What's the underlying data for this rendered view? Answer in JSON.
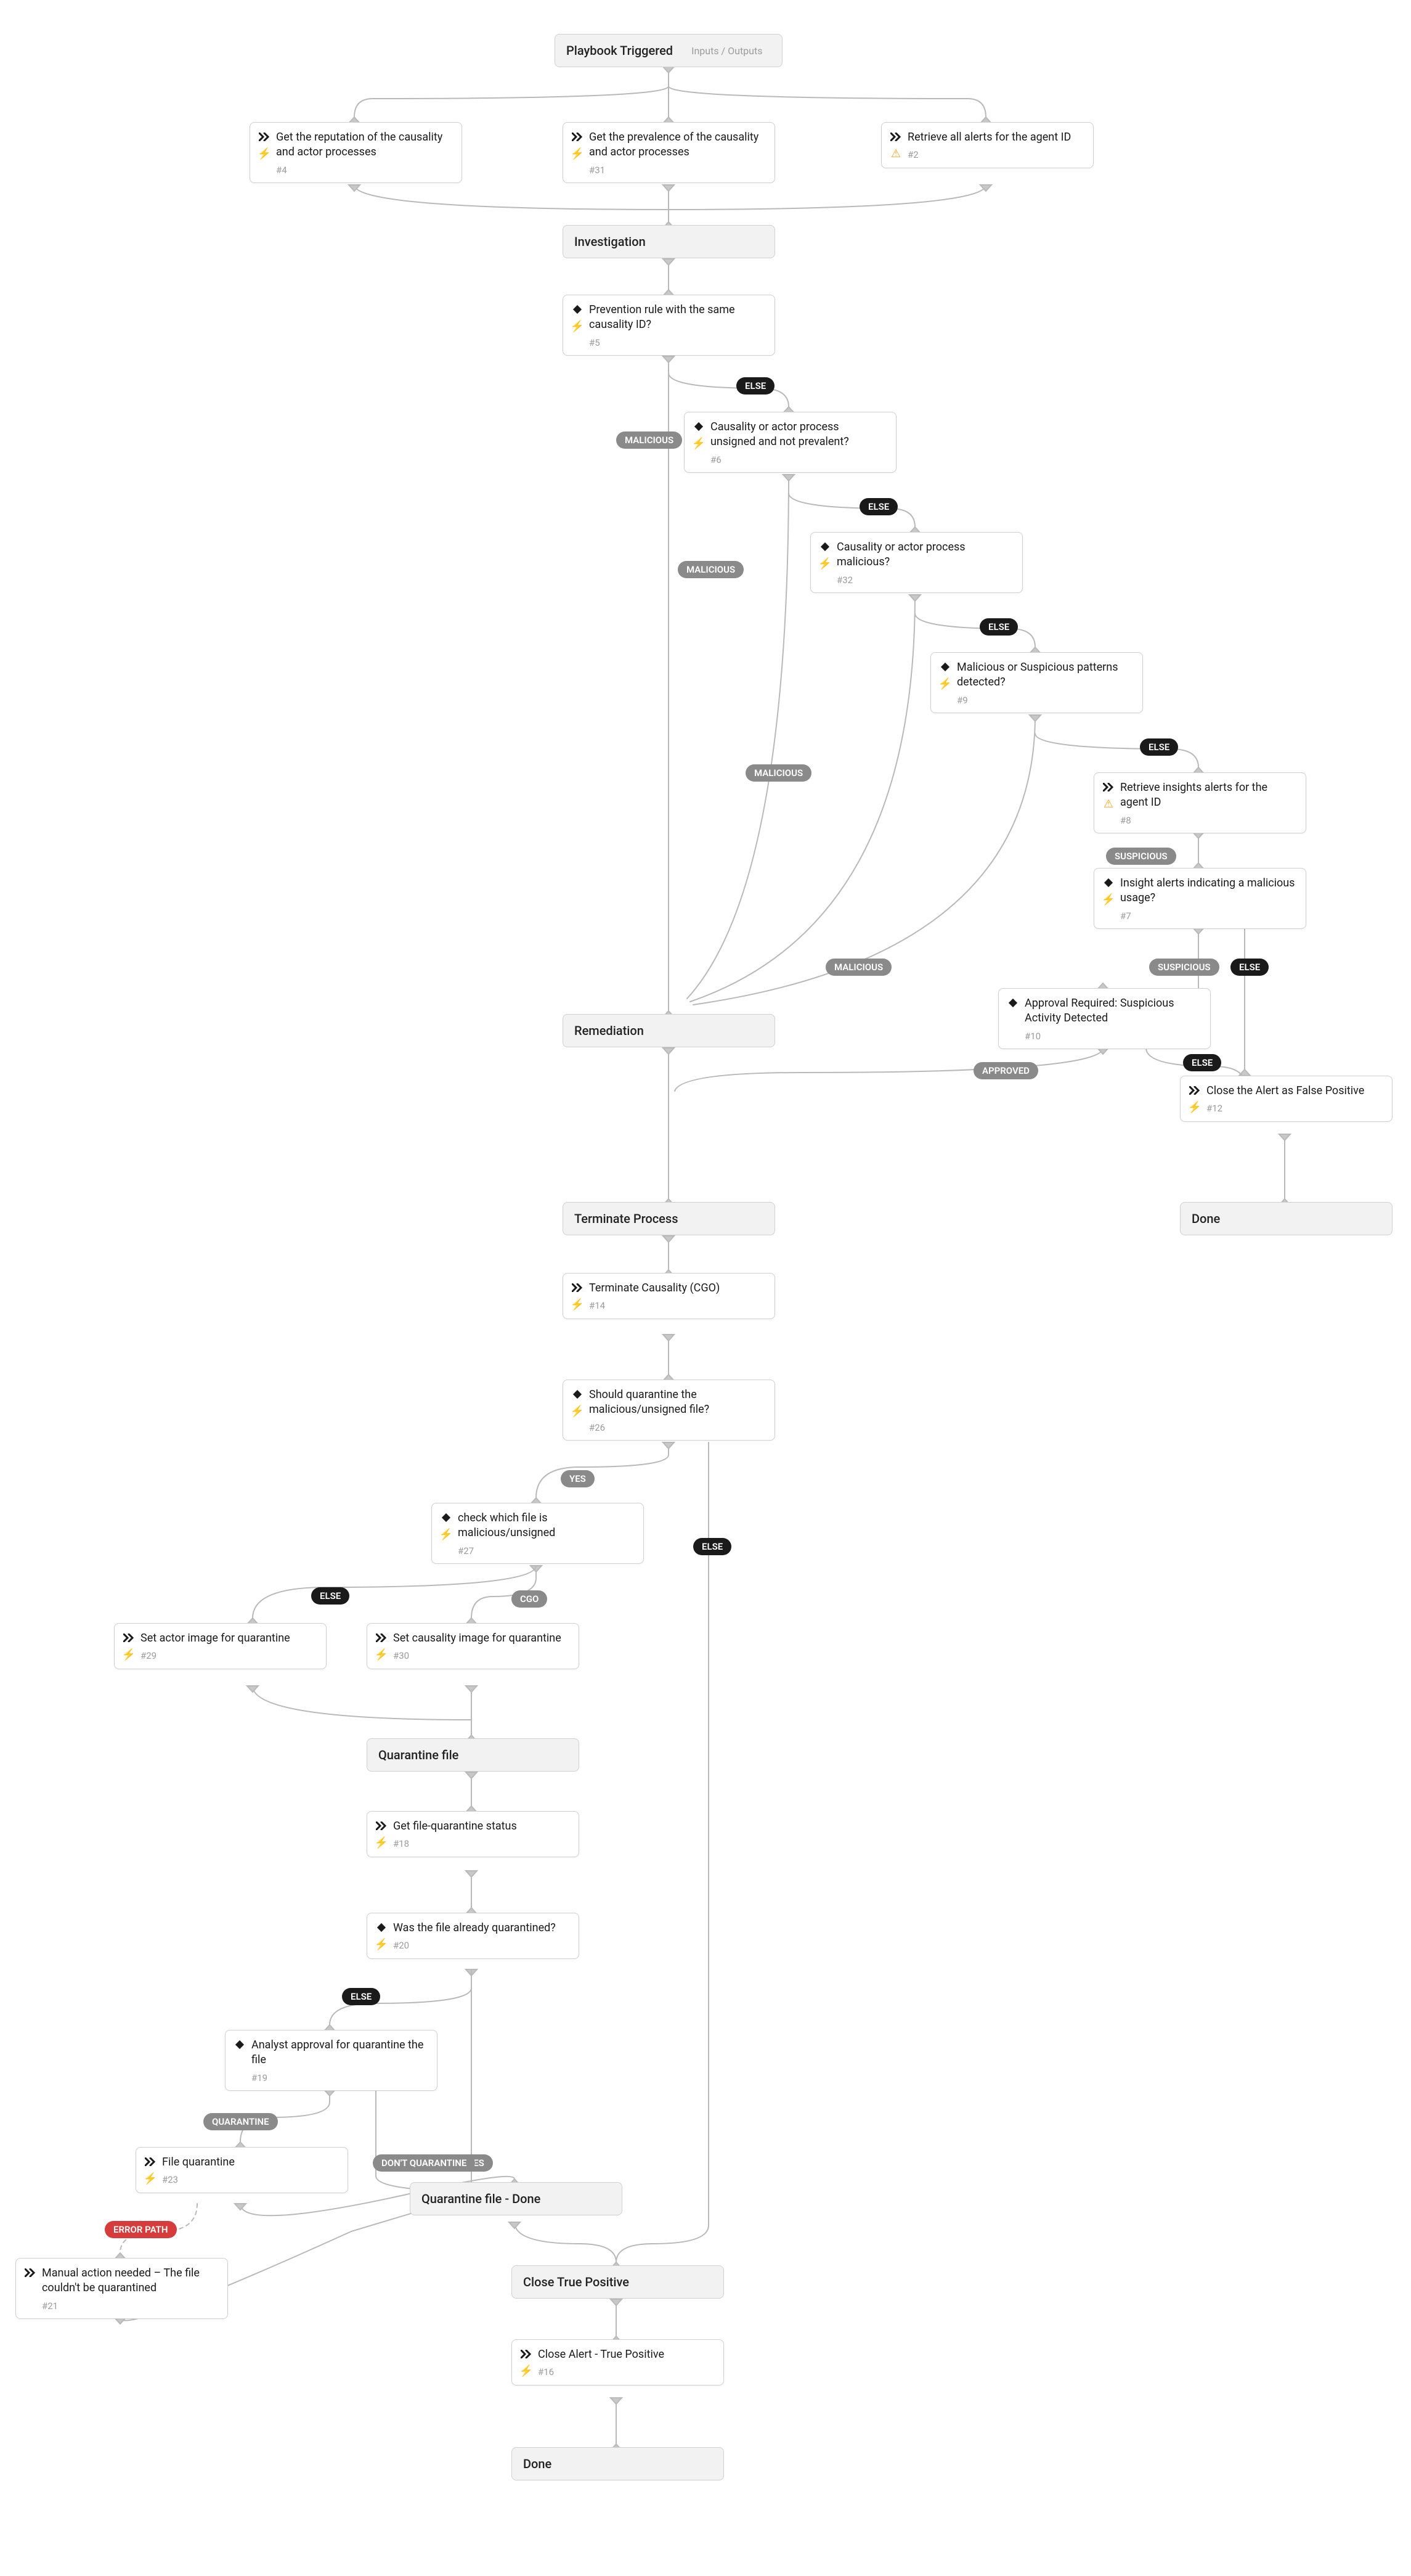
{
  "trigger": {
    "title": "Playbook Triggered",
    "io": "Inputs / Outputs"
  },
  "sections": {
    "investigation": "Investigation",
    "remediation": "Remediation",
    "terminate": "Terminate Process",
    "quarantine_file": "Quarantine file",
    "quarantine_done": "Quarantine file - Done",
    "close_true": "Close True Positive",
    "done_main": "Done",
    "done_fp": "Done"
  },
  "tasks": {
    "t4": {
      "title": "Get the reputation of the causality and actor processes",
      "sub": "#4"
    },
    "t31": {
      "title": "Get the prevalence of the causality and actor processes",
      "sub": "#31"
    },
    "t2": {
      "title": "Retrieve all alerts for the agent ID",
      "sub": "#2"
    },
    "t5": {
      "title": "Prevention rule with the same causality ID?",
      "sub": "#5"
    },
    "t6": {
      "title": "Causality or actor process unsigned and not prevalent?",
      "sub": "#6"
    },
    "t32": {
      "title": "Causality or actor process malicious?",
      "sub": "#32"
    },
    "t9": {
      "title": "Malicious or Suspicious patterns detected?",
      "sub": "#9"
    },
    "t8": {
      "title": "Retrieve insights alerts for the agent ID",
      "sub": "#8"
    },
    "t7": {
      "title": "Insight alerts indicating a malicious usage?",
      "sub": "#7"
    },
    "t10": {
      "title": "Approval Required: Suspicious Activity Detected",
      "sub": "#10"
    },
    "t12": {
      "title": "Close the Alert as False Positive",
      "sub": "#12"
    },
    "t14": {
      "title": "Terminate Causality (CGO)",
      "sub": "#14"
    },
    "t26": {
      "title": "Should quarantine the malicious/unsigned file?",
      "sub": "#26"
    },
    "t27": {
      "title": "check which file is malicious/unsigned",
      "sub": "#27"
    },
    "t29": {
      "title": "Set actor image for quarantine",
      "sub": "#29"
    },
    "t30": {
      "title": "Set causality image for quarantine",
      "sub": "#30"
    },
    "t18": {
      "title": "Get file-quarantine status",
      "sub": "#18"
    },
    "t20": {
      "title": "Was the file already quarantined?",
      "sub": "#20"
    },
    "t19": {
      "title": "Analyst approval for quarantine the file",
      "sub": "#19"
    },
    "t23": {
      "title": "File quarantine",
      "sub": "#23"
    },
    "t21": {
      "title": "Manual action needed – The file couldn't be quarantined",
      "sub": "#21"
    },
    "t16": {
      "title": "Close Alert - True Positive",
      "sub": "#16"
    }
  },
  "labels": {
    "else": "ELSE",
    "malicious": "MALICIOUS",
    "suspicious": "SUSPICIOUS",
    "approved": "APPROVED",
    "yes": "YES",
    "cgo": "CGO",
    "quarantine": "QUARANTINE",
    "dont_quarantine": "DON'T QUARANTINE",
    "error_path": "ERROR PATH"
  }
}
